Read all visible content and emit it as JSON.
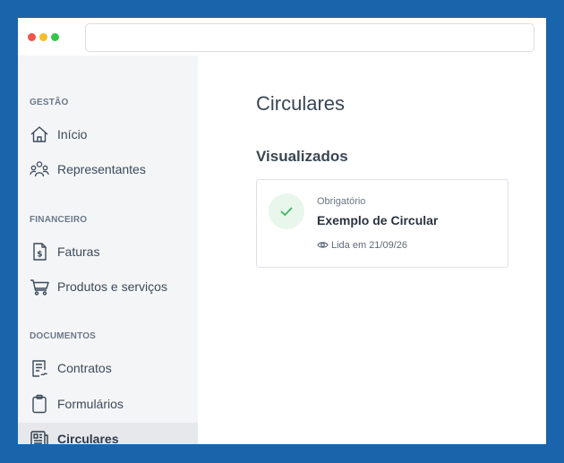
{
  "window": {
    "address_value": ""
  },
  "sidebar": {
    "sections": [
      {
        "title": "GESTÃO",
        "items": [
          {
            "label": "Início",
            "icon": "home-icon"
          },
          {
            "label": "Representantes",
            "icon": "users-icon"
          }
        ]
      },
      {
        "title": "FINANCEIRO",
        "items": [
          {
            "label": "Faturas",
            "icon": "invoice-icon"
          },
          {
            "label": "Produtos e serviços",
            "icon": "cart-icon"
          }
        ]
      },
      {
        "title": "DOCUMENTOS",
        "items": [
          {
            "label": "Contratos",
            "icon": "contract-icon"
          },
          {
            "label": "Formulários",
            "icon": "clipboard-icon"
          },
          {
            "label": "Circulares",
            "icon": "newspaper-icon",
            "active": true
          }
        ]
      }
    ]
  },
  "main": {
    "title": "Circulares",
    "section_heading": "Visualizados",
    "card": {
      "tag": "Obrigatório",
      "title": "Exemplo de Circular",
      "meta": "Lida em 21/09/26",
      "status_icon": "check-icon",
      "meta_icon": "eye-icon"
    }
  },
  "colors": {
    "background": "#1a64ab",
    "sidebar": "#f4f5f7",
    "active_item": "#e6e8ec",
    "check_green": "#3fb561",
    "check_bg": "#e8f6ec",
    "text_dark": "#3a4654"
  }
}
